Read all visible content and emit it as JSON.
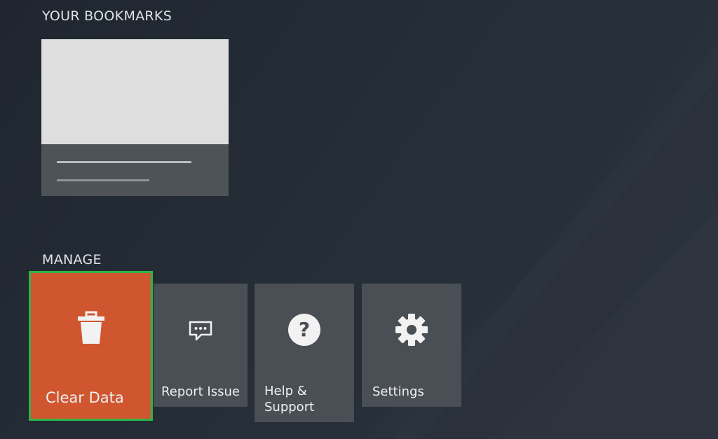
{
  "bookmarks": {
    "heading": "YOUR BOOKMARKS"
  },
  "manage": {
    "heading": "MANAGE",
    "tiles": [
      {
        "label": "Clear Data",
        "icon": "trash-icon",
        "selected": true
      },
      {
        "label": "Report Issue",
        "icon": "speech-bubble-icon",
        "selected": false
      },
      {
        "label": "Help & Support",
        "icon": "help-question-icon",
        "selected": false
      },
      {
        "label": "Settings",
        "icon": "gear-icon",
        "selected": false
      }
    ]
  },
  "colors": {
    "background": "#232b35",
    "selected_tile": "#d0562f",
    "focus_border": "#2fb34a",
    "tile": "#4a4f55"
  }
}
